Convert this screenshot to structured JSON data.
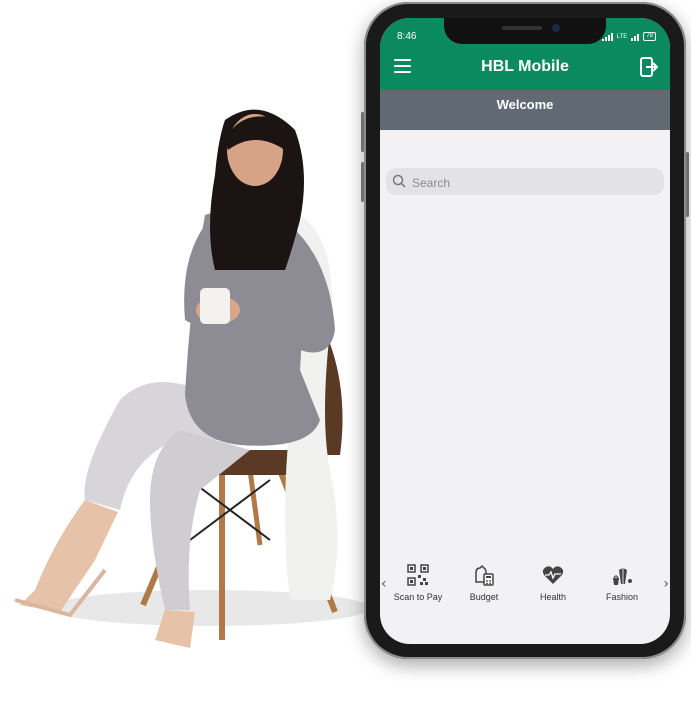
{
  "status_bar": {
    "time": "8:46",
    "network": "LTE",
    "battery": "78"
  },
  "header": {
    "title": "HBL Mobile",
    "subtitle": "Welcome"
  },
  "search": {
    "placeholder": "Search"
  },
  "categories": [
    {
      "label": "Scan to Pay",
      "icon": "qr-code-icon"
    },
    {
      "label": "Budget",
      "icon": "budget-icon"
    },
    {
      "label": "Health",
      "icon": "heart-pulse-icon"
    },
    {
      "label": "Fashion",
      "icon": "fashion-icon"
    }
  ],
  "colors": {
    "brand_green": "#0a8a5e",
    "welcome_bar": "#616972",
    "screen_bg": "#f2f2f4"
  }
}
